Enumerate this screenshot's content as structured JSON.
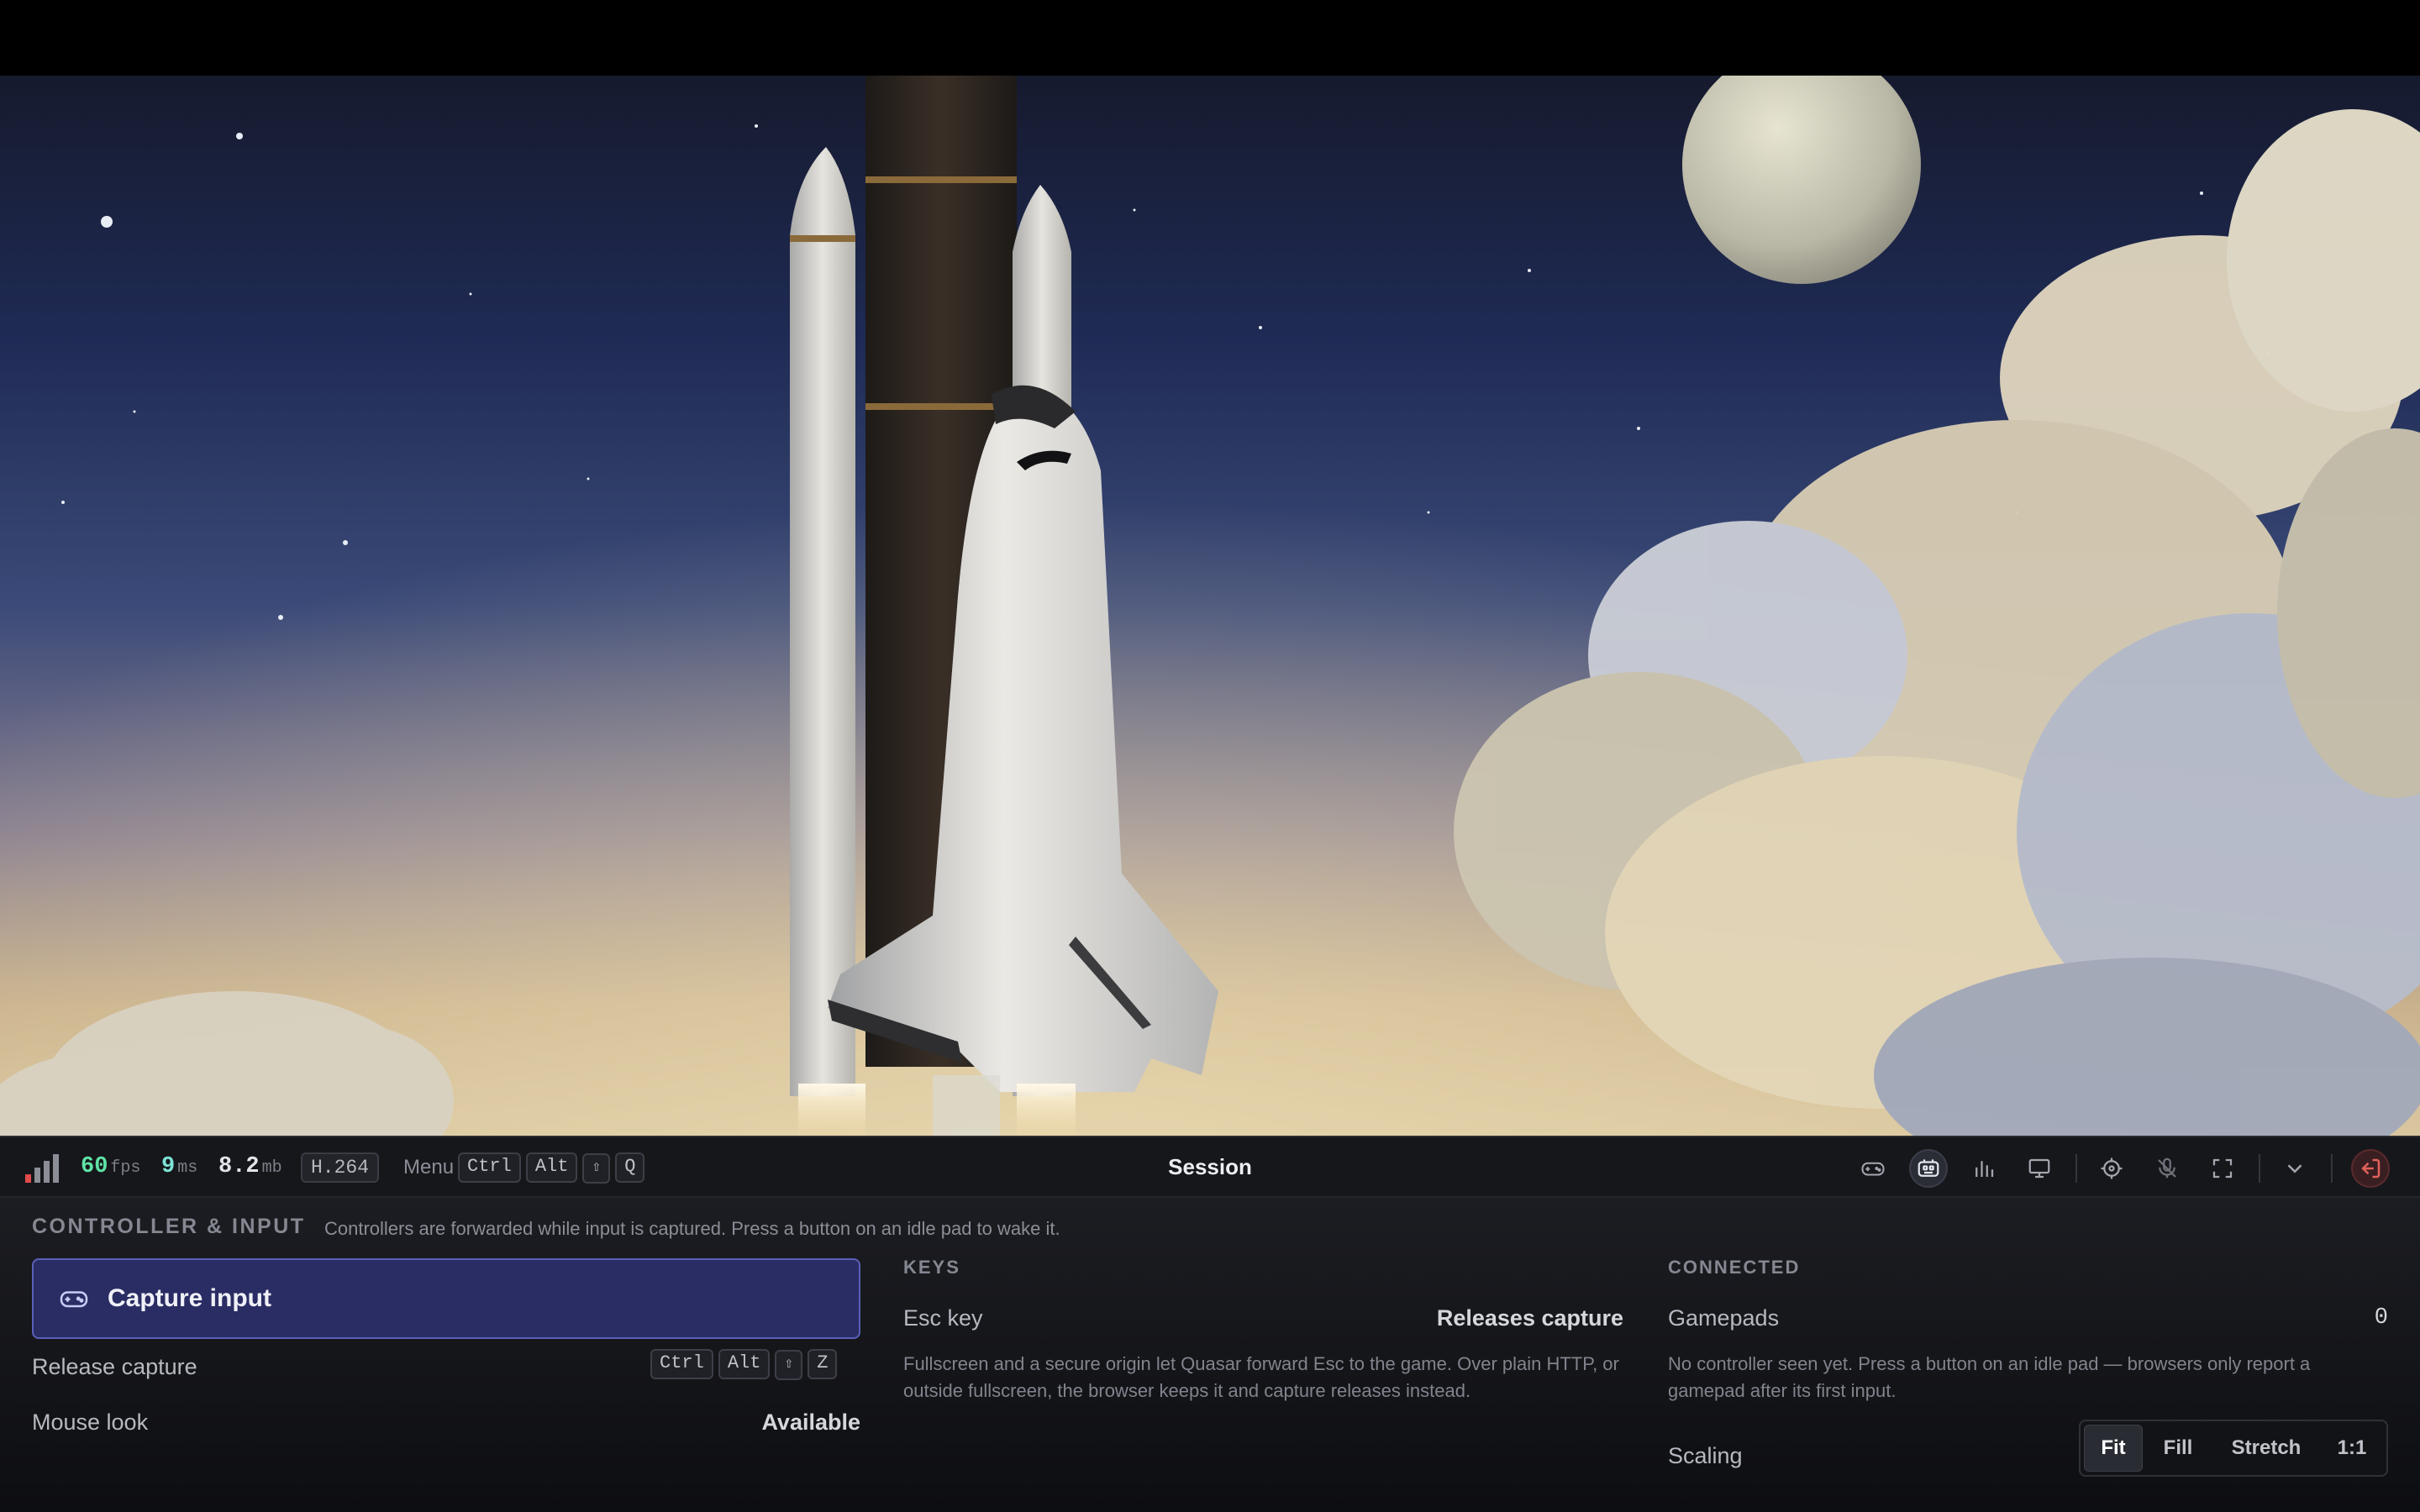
{
  "toolbar": {
    "fps_value": "60",
    "fps_unit": "fps",
    "latency_value": "9",
    "latency_unit": "ms",
    "bitrate_value": "8.2",
    "bitrate_unit": "mb",
    "codec": "H.264",
    "menu_label": "Menu",
    "menu_keys": [
      "Ctrl",
      "Alt",
      "⇧",
      "Q"
    ],
    "title": "Session",
    "icons": [
      "gamepad-icon",
      "keyboard-mouse-icon",
      "stats-icon",
      "display-icon",
      "crosshair-icon",
      "mic-off-icon",
      "fullscreen-icon",
      "chevron-down-icon",
      "exit-icon"
    ]
  },
  "panel": {
    "heading": "CONTROLLER & INPUT",
    "subheading": "Controllers are forwarded while input is captured. Press a button on an idle pad to wake it.",
    "capture_button": "Capture input",
    "release_label": "Release capture",
    "release_keys": [
      "Ctrl",
      "Alt",
      "⇧",
      "Z"
    ],
    "mouse_look_label": "Mouse look",
    "mouse_look_value": "Available",
    "keys": {
      "heading": "KEYS",
      "esc_label": "Esc key",
      "esc_value": "Releases capture",
      "help": "Fullscreen and a secure origin let Quasar forward Esc to the game. Over plain HTTP, or outside fullscreen, the browser keeps it and capture releases instead."
    },
    "connected": {
      "heading": "CONNECTED",
      "gamepads_label": "Gamepads",
      "gamepads_value": "0",
      "help": "No controller seen yet. Press a button on an idle pad — browsers only report a gamepad after its first input.",
      "scaling_label": "Scaling",
      "scaling_options": [
        "Fit",
        "Fill",
        "Stretch",
        "1:1"
      ],
      "scaling_selected": "Fit"
    }
  },
  "colors": {
    "accent_green": "#5fe3a6",
    "accent_teal": "#7de3d6",
    "capture_bg": "#2a2d63",
    "capture_border": "#5a5fb8",
    "exit_red": "#e0625b",
    "signal_red": "#e04b4b"
  }
}
